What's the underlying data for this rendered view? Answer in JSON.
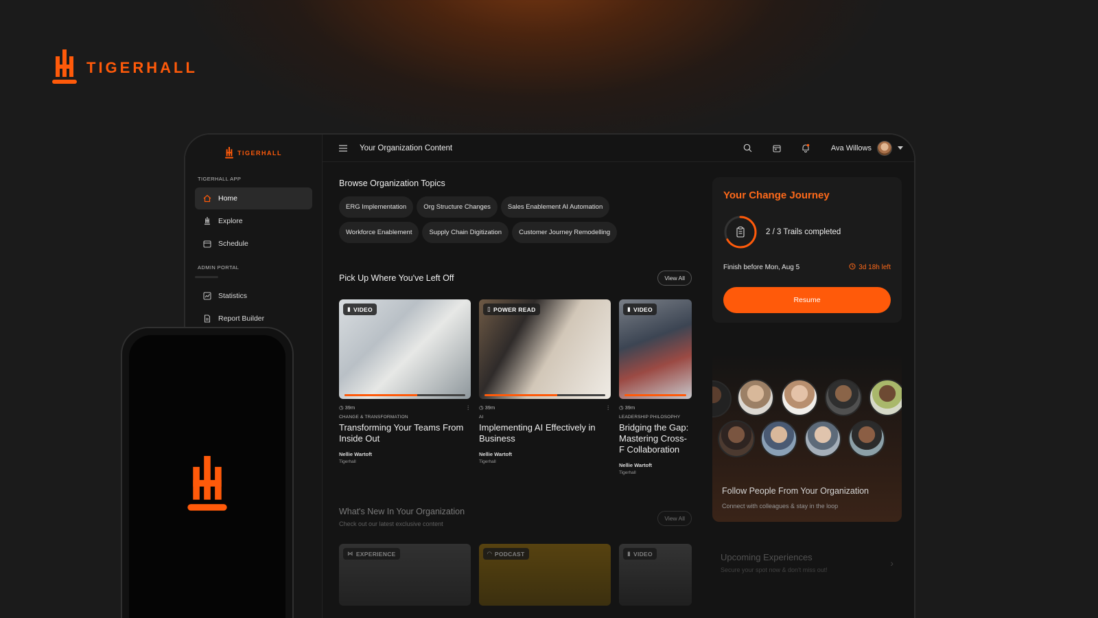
{
  "brand": {
    "name": "TIGERHALL",
    "color": "#ff5a0a"
  },
  "sidebar": {
    "logo_text": "TIGERHALL",
    "section_app": "TIGERHALL APP",
    "items": [
      {
        "label": "Home",
        "icon": "home-icon",
        "active": true
      },
      {
        "label": "Explore",
        "icon": "tigerhall-icon"
      },
      {
        "label": "Schedule",
        "icon": "calendar-icon"
      }
    ],
    "section_admin": "ADMIN PORTAL",
    "admin_items": [
      {
        "label": "Statistics",
        "icon": "chart-icon"
      },
      {
        "label": "Report Builder",
        "icon": "report-icon"
      }
    ]
  },
  "topbar": {
    "title": "Your Organization Content",
    "user_name": "Ava Willows"
  },
  "topics": {
    "title": "Browse Organization Topics",
    "chips": [
      "ERG Implementation",
      "Org Structure Changes",
      "Sales Enablement AI Automation",
      "Workforce Enablement",
      "Supply Chain Digitization",
      "Customer Journey Remodelling"
    ]
  },
  "pickup": {
    "title": "Pick Up Where You've Left Off",
    "view_all": "View All",
    "cards": [
      {
        "badge": "VIDEO",
        "duration": "39m",
        "category": "CHANGE & TRANSFORMATION",
        "title": "Transforming Your Teams From Inside Out",
        "author": "Nellie Wartoft",
        "org": "Tigerhall",
        "progress": 0.6
      },
      {
        "badge": "POWER READ",
        "duration": "39m",
        "category": "AI",
        "title": "Implementing AI Effectively in Business",
        "author": "Nellie Wartoft",
        "org": "Tigerhall",
        "progress": 0.6
      },
      {
        "badge": "VIDEO",
        "duration": "39m",
        "category": "LEADERSHIP PHILOSOPHY",
        "title": "Bridging the Gap: Mastering Cross-F Collaboration",
        "author": "Nellie Wartoft",
        "org": "Tigerhall",
        "progress": 1.0
      }
    ]
  },
  "whats_new": {
    "title": "What's New In Your Organization",
    "subtitle": "Check out our latest exclusive content",
    "view_all": "View All",
    "badges": [
      "EXPERIENCE",
      "PODCAST",
      "VIDEO"
    ]
  },
  "journey": {
    "title": "Your Change Journey",
    "trails": "2 / 3  Trails completed",
    "completed": 2,
    "total": 3,
    "finish": "Finish before Mon, Aug 5",
    "time_left": "3d 18h left",
    "resume": "Resume"
  },
  "people": {
    "title": "Follow People From Your Organization",
    "subtitle": "Connect with colleagues & stay in the loop"
  },
  "upcoming": {
    "title": "Upcoming Experiences",
    "subtitle": "Secure your spot now & don't miss out!"
  }
}
